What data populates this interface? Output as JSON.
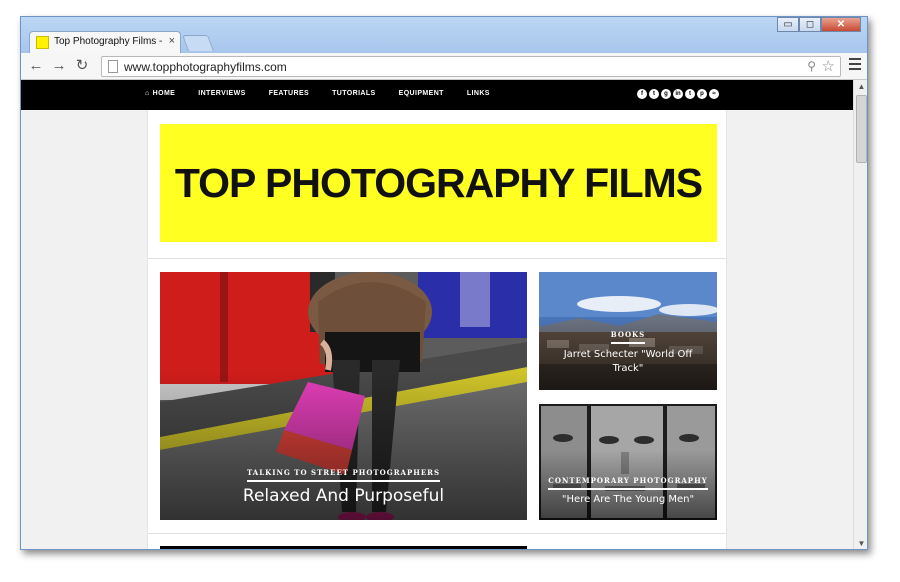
{
  "browser": {
    "tab_title": "Top Photography Films - I",
    "tab_close": "×",
    "url": "www.topphotographyfilms.com",
    "window_controls": {
      "minimize": "▭",
      "maximize": "◻",
      "close": "✕"
    },
    "nav": {
      "back": "←",
      "forward": "→",
      "reload": "↻"
    }
  },
  "site": {
    "menu": [
      {
        "label": "HOME",
        "icon": "home-icon"
      },
      {
        "label": "INTERVIEWS"
      },
      {
        "label": "FEATURES"
      },
      {
        "label": "TUTORIALS"
      },
      {
        "label": "EQUIPMENT"
      },
      {
        "label": "LINKS"
      }
    ],
    "social_icons": [
      "f",
      "t",
      "g",
      "in",
      "t",
      "p",
      "rss"
    ],
    "banner_title": "TOP PHOTOGRAPHY FILMS",
    "banner_color": "#ffff22",
    "main_feature": {
      "category": "TALKING TO STREET PHOTOGRAPHERS",
      "title": "Relaxed And Purposeful"
    },
    "side_features": [
      {
        "category": "BOOKS",
        "title": "Jarret Schecter \"World Off Track\""
      },
      {
        "category": "CONTEMPORARY PHOTOGRAPHY",
        "title": "\"Here Are The Young Men\""
      }
    ]
  }
}
